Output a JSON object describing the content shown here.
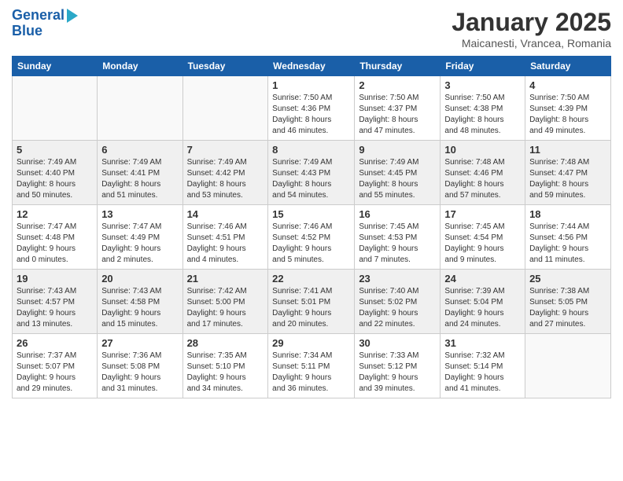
{
  "header": {
    "logo_line1": "General",
    "logo_line2": "Blue",
    "month_title": "January 2025",
    "location": "Maicanesti, Vrancea, Romania"
  },
  "weekdays": [
    "Sunday",
    "Monday",
    "Tuesday",
    "Wednesday",
    "Thursday",
    "Friday",
    "Saturday"
  ],
  "weeks": [
    [
      {
        "day": "",
        "info": ""
      },
      {
        "day": "",
        "info": ""
      },
      {
        "day": "",
        "info": ""
      },
      {
        "day": "1",
        "info": "Sunrise: 7:50 AM\nSunset: 4:36 PM\nDaylight: 8 hours\nand 46 minutes."
      },
      {
        "day": "2",
        "info": "Sunrise: 7:50 AM\nSunset: 4:37 PM\nDaylight: 8 hours\nand 47 minutes."
      },
      {
        "day": "3",
        "info": "Sunrise: 7:50 AM\nSunset: 4:38 PM\nDaylight: 8 hours\nand 48 minutes."
      },
      {
        "day": "4",
        "info": "Sunrise: 7:50 AM\nSunset: 4:39 PM\nDaylight: 8 hours\nand 49 minutes."
      }
    ],
    [
      {
        "day": "5",
        "info": "Sunrise: 7:49 AM\nSunset: 4:40 PM\nDaylight: 8 hours\nand 50 minutes."
      },
      {
        "day": "6",
        "info": "Sunrise: 7:49 AM\nSunset: 4:41 PM\nDaylight: 8 hours\nand 51 minutes."
      },
      {
        "day": "7",
        "info": "Sunrise: 7:49 AM\nSunset: 4:42 PM\nDaylight: 8 hours\nand 53 minutes."
      },
      {
        "day": "8",
        "info": "Sunrise: 7:49 AM\nSunset: 4:43 PM\nDaylight: 8 hours\nand 54 minutes."
      },
      {
        "day": "9",
        "info": "Sunrise: 7:49 AM\nSunset: 4:45 PM\nDaylight: 8 hours\nand 55 minutes."
      },
      {
        "day": "10",
        "info": "Sunrise: 7:48 AM\nSunset: 4:46 PM\nDaylight: 8 hours\nand 57 minutes."
      },
      {
        "day": "11",
        "info": "Sunrise: 7:48 AM\nSunset: 4:47 PM\nDaylight: 8 hours\nand 59 minutes."
      }
    ],
    [
      {
        "day": "12",
        "info": "Sunrise: 7:47 AM\nSunset: 4:48 PM\nDaylight: 9 hours\nand 0 minutes."
      },
      {
        "day": "13",
        "info": "Sunrise: 7:47 AM\nSunset: 4:49 PM\nDaylight: 9 hours\nand 2 minutes."
      },
      {
        "day": "14",
        "info": "Sunrise: 7:46 AM\nSunset: 4:51 PM\nDaylight: 9 hours\nand 4 minutes."
      },
      {
        "day": "15",
        "info": "Sunrise: 7:46 AM\nSunset: 4:52 PM\nDaylight: 9 hours\nand 5 minutes."
      },
      {
        "day": "16",
        "info": "Sunrise: 7:45 AM\nSunset: 4:53 PM\nDaylight: 9 hours\nand 7 minutes."
      },
      {
        "day": "17",
        "info": "Sunrise: 7:45 AM\nSunset: 4:54 PM\nDaylight: 9 hours\nand 9 minutes."
      },
      {
        "day": "18",
        "info": "Sunrise: 7:44 AM\nSunset: 4:56 PM\nDaylight: 9 hours\nand 11 minutes."
      }
    ],
    [
      {
        "day": "19",
        "info": "Sunrise: 7:43 AM\nSunset: 4:57 PM\nDaylight: 9 hours\nand 13 minutes."
      },
      {
        "day": "20",
        "info": "Sunrise: 7:43 AM\nSunset: 4:58 PM\nDaylight: 9 hours\nand 15 minutes."
      },
      {
        "day": "21",
        "info": "Sunrise: 7:42 AM\nSunset: 5:00 PM\nDaylight: 9 hours\nand 17 minutes."
      },
      {
        "day": "22",
        "info": "Sunrise: 7:41 AM\nSunset: 5:01 PM\nDaylight: 9 hours\nand 20 minutes."
      },
      {
        "day": "23",
        "info": "Sunrise: 7:40 AM\nSunset: 5:02 PM\nDaylight: 9 hours\nand 22 minutes."
      },
      {
        "day": "24",
        "info": "Sunrise: 7:39 AM\nSunset: 5:04 PM\nDaylight: 9 hours\nand 24 minutes."
      },
      {
        "day": "25",
        "info": "Sunrise: 7:38 AM\nSunset: 5:05 PM\nDaylight: 9 hours\nand 27 minutes."
      }
    ],
    [
      {
        "day": "26",
        "info": "Sunrise: 7:37 AM\nSunset: 5:07 PM\nDaylight: 9 hours\nand 29 minutes."
      },
      {
        "day": "27",
        "info": "Sunrise: 7:36 AM\nSunset: 5:08 PM\nDaylight: 9 hours\nand 31 minutes."
      },
      {
        "day": "28",
        "info": "Sunrise: 7:35 AM\nSunset: 5:10 PM\nDaylight: 9 hours\nand 34 minutes."
      },
      {
        "day": "29",
        "info": "Sunrise: 7:34 AM\nSunset: 5:11 PM\nDaylight: 9 hours\nand 36 minutes."
      },
      {
        "day": "30",
        "info": "Sunrise: 7:33 AM\nSunset: 5:12 PM\nDaylight: 9 hours\nand 39 minutes."
      },
      {
        "day": "31",
        "info": "Sunrise: 7:32 AM\nSunset: 5:14 PM\nDaylight: 9 hours\nand 41 minutes."
      },
      {
        "day": "",
        "info": ""
      }
    ]
  ]
}
